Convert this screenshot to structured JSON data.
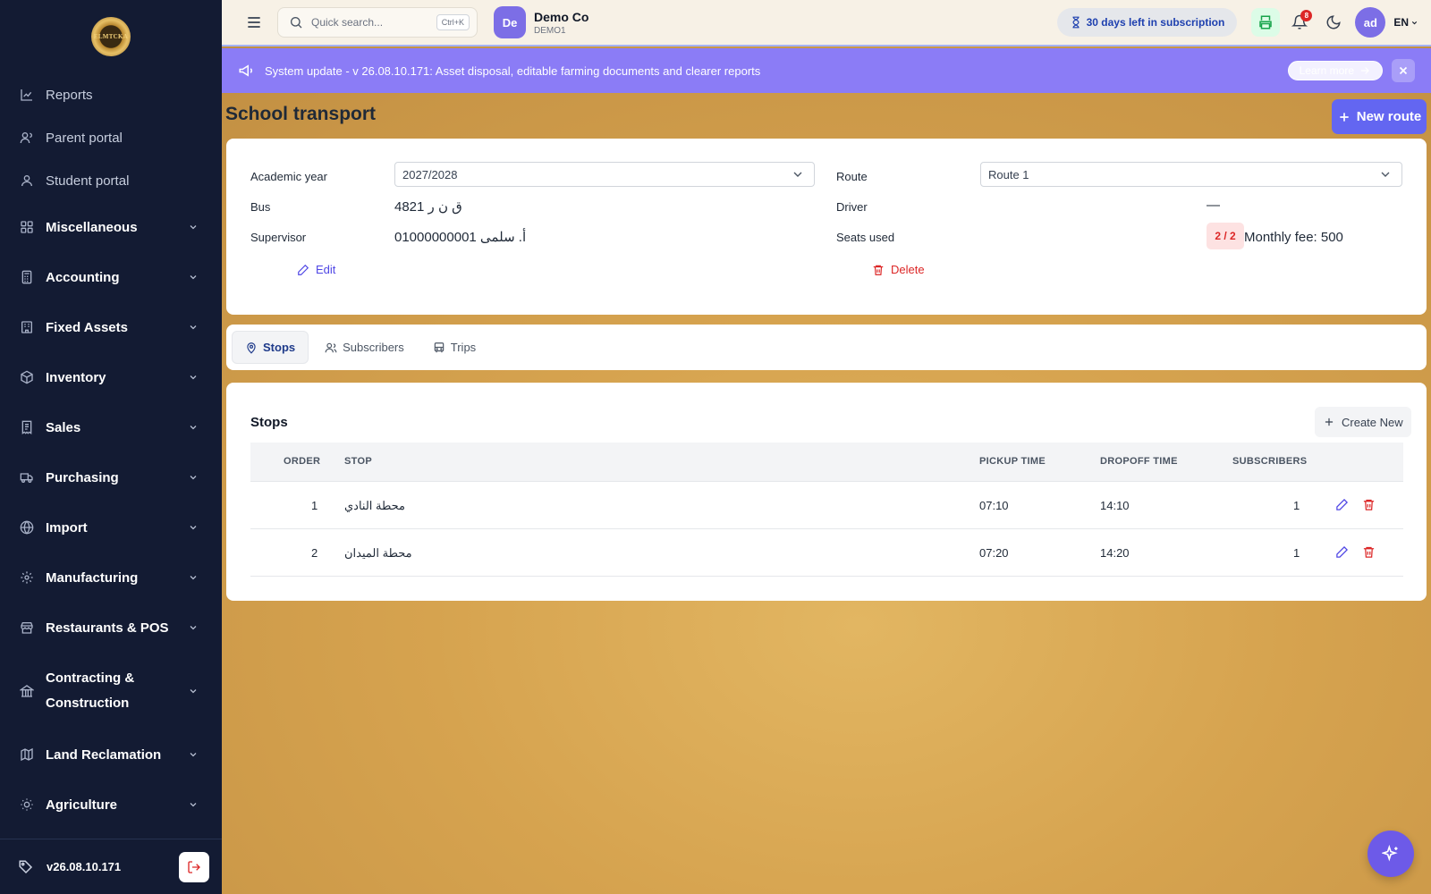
{
  "sidebar": {
    "logo_text": "ELMTCKA",
    "items": [
      {
        "label": "Reports",
        "icon": "chart-line-icon"
      },
      {
        "label": "Parent portal",
        "icon": "users-icon"
      },
      {
        "label": "Student portal",
        "icon": "user-icon"
      }
    ],
    "groups": [
      {
        "label": "Miscellaneous",
        "icon": "grid-icon"
      },
      {
        "label": "Accounting",
        "icon": "calculator-icon"
      },
      {
        "label": "Fixed Assets",
        "icon": "building-icon"
      },
      {
        "label": "Inventory",
        "icon": "box-icon"
      },
      {
        "label": "Sales",
        "icon": "receipt-icon"
      },
      {
        "label": "Purchasing",
        "icon": "truck-icon"
      },
      {
        "label": "Import",
        "icon": "globe-icon"
      },
      {
        "label": "Manufacturing",
        "icon": "cog-icon"
      },
      {
        "label": "Restaurants & POS",
        "icon": "store-icon"
      },
      {
        "label": "Contracting & Construction",
        "icon": "landmark-icon"
      },
      {
        "label": "Land Reclamation",
        "icon": "map-icon"
      },
      {
        "label": "Agriculture",
        "icon": "sun-icon"
      }
    ],
    "version": "v26.08.10.171"
  },
  "topbar": {
    "search_placeholder": "Quick search...",
    "search_shortcut": "Ctrl+K",
    "company_initials": "De",
    "company_name": "Demo Co",
    "company_code": "DEMO1",
    "subscription": "30 days left in subscription",
    "notifications_count": "8",
    "user_initials": "ad",
    "language": "EN"
  },
  "banner": {
    "text": "System update - v 26.08.10.171: Asset disposal, editable farming documents and clearer reports",
    "learn_more": "Learn more"
  },
  "page": {
    "title": "School transport",
    "new_route": "New route"
  },
  "route_info": {
    "academic_year_label": "Academic year",
    "academic_year_value": "2027/2028",
    "route_label": "Route",
    "route_value": "Route 1",
    "bus_label": "Bus",
    "bus_value": "ق ن ر 4821",
    "driver_label": "Driver",
    "driver_value": "—",
    "supervisor_label": "Supervisor",
    "supervisor_value": "أ. سلمى 01000000001",
    "seats_label": "Seats used",
    "seats_value": "2 / 2",
    "monthly_fee": "Monthly fee: 500",
    "edit": "Edit",
    "delete": "Delete"
  },
  "tabs": [
    {
      "label": "Stops",
      "active": true
    },
    {
      "label": "Subscribers",
      "active": false
    },
    {
      "label": "Trips",
      "active": false
    }
  ],
  "stops": {
    "title": "Stops",
    "create_new": "Create New",
    "columns": [
      "ORDER",
      "STOP",
      "PICKUP TIME",
      "DROPOFF TIME",
      "SUBSCRIBERS"
    ],
    "rows": [
      {
        "order": "1",
        "stop": "محطة النادي",
        "pickup": "07:10",
        "dropoff": "14:10",
        "subscribers": "1"
      },
      {
        "order": "2",
        "stop": "محطة الميدان",
        "pickup": "07:20",
        "dropoff": "14:20",
        "subscribers": "1"
      }
    ]
  }
}
